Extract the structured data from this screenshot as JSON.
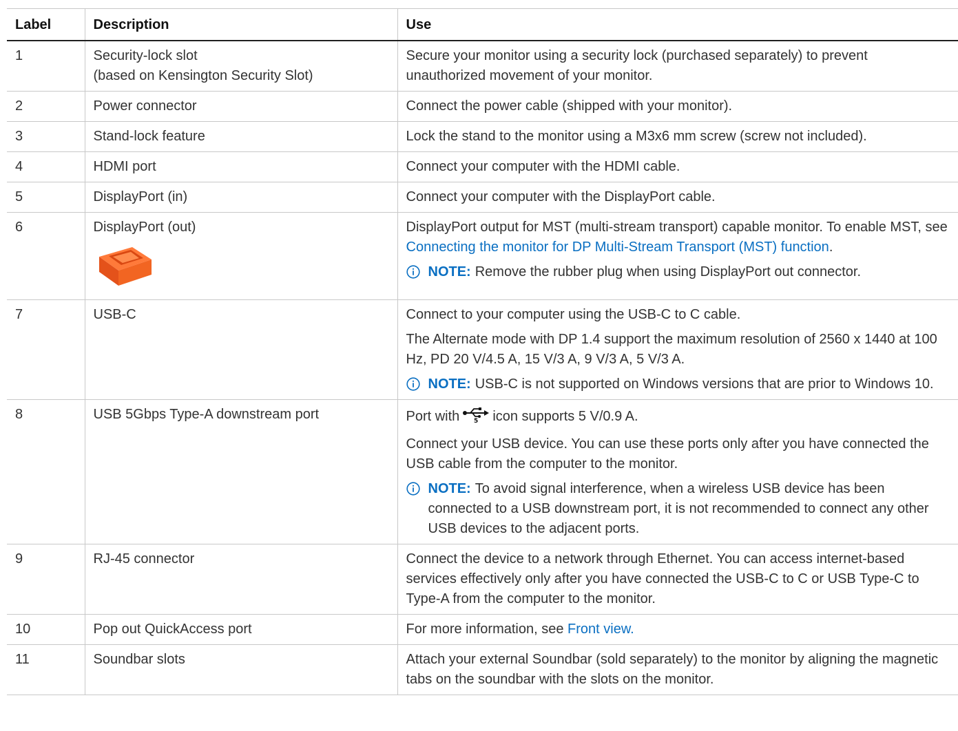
{
  "table": {
    "headers": {
      "label": "Label",
      "description": "Description",
      "use": "Use"
    },
    "rows": [
      {
        "label": "1",
        "description": [
          "Security-lock slot",
          "(based on Kensington Security Slot)"
        ],
        "use": "Secure your monitor using a security lock (purchased separately) to prevent unauthorized movement of your monitor."
      },
      {
        "label": "2",
        "description": [
          "Power connector"
        ],
        "use": "Connect the power cable (shipped with your monitor)."
      },
      {
        "label": "3",
        "description": [
          "Stand-lock feature"
        ],
        "use": "Lock the stand to the monitor using a M3x6 mm screw (screw not included)."
      },
      {
        "label": "4",
        "description": [
          "HDMI port"
        ],
        "use": "Connect your computer with the HDMI cable."
      },
      {
        "label": "5",
        "description": [
          "DisplayPort (in)"
        ],
        "use": "Connect your computer with the DisplayPort cable."
      },
      {
        "label": "6",
        "description": [
          "DisplayPort (out)"
        ],
        "use_prefix": "DisplayPort output for MST (multi-stream transport) capable monitor. To enable MST, see ",
        "use_link": "Connecting the monitor for DP Multi-Stream Transport (MST) function",
        "use_suffix": ".",
        "note_label": "NOTE:",
        "note_text": "Remove the rubber plug when using DisplayPort out connector.",
        "image_color": "#f26522"
      },
      {
        "label": "7",
        "description": [
          "USB-C"
        ],
        "use": "Connect to your computer using the USB-C to C cable.",
        "use2": "The Alternate mode with DP 1.4 support the maximum resolution of 2560 x 1440 at 100 Hz, PD 20 V/4.5 A, 15 V/3 A, 9 V/3 A, 5 V/3 A.",
        "note_label": "NOTE:",
        "note_text": "USB-C is not supported on Windows versions that are prior to Windows 10."
      },
      {
        "label": "8",
        "description": [
          "USB 5Gbps Type-A downstream port"
        ],
        "use_prefix": "Port with",
        "icon_label": "5",
        "use_suffix": "icon supports 5 V/0.9 A.",
        "use2": "Connect your USB device. You can use these ports only after you have connected the USB cable from the computer to the monitor.",
        "note_label": "NOTE:",
        "note_text": "To avoid signal interference, when a wireless USB device has been connected to a USB downstream port, it is not recommended to connect any other USB devices to the adjacent ports."
      },
      {
        "label": "9",
        "description": [
          "RJ-45 connector"
        ],
        "use": "Connect the device to a network through Ethernet. You can access internet-based services effectively only after you have connected the USB-C to C or USB Type-C to Type-A from the computer to the monitor."
      },
      {
        "label": "10",
        "description": [
          "Pop out QuickAccess port"
        ],
        "use_prefix": "For more information, see ",
        "use_link": "Front view."
      },
      {
        "label": "11",
        "description": [
          "Soundbar slots"
        ],
        "use": "Attach your external Soundbar (sold separately) to the monitor by aligning the magnetic tabs on the soundbar with the slots on the monitor."
      }
    ]
  },
  "colors": {
    "link": "#0a6fc2",
    "note_label": "#0a6fc2",
    "plug": "#f26522"
  },
  "icons": {
    "note": "info-circle-icon",
    "usb": "usb-icon"
  }
}
